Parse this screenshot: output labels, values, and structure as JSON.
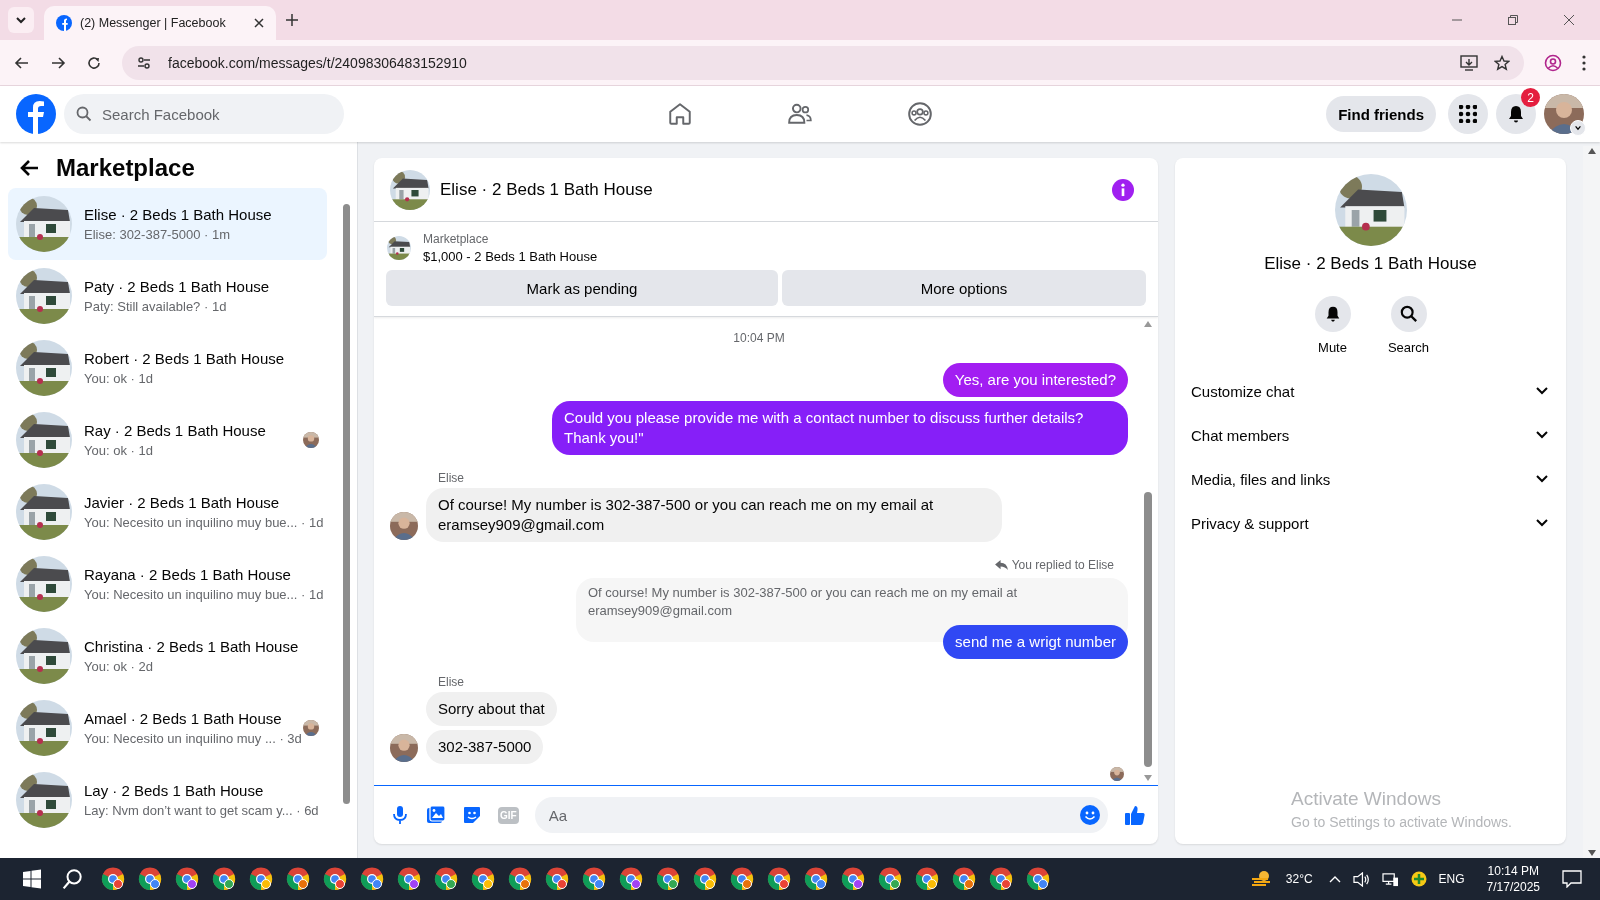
{
  "browser": {
    "tab_title": "(2) Messenger | Facebook",
    "url": "facebook.com/messages/t/24098306483152910"
  },
  "header": {
    "search_placeholder": "Search Facebook",
    "find_friends": "Find friends",
    "notification_count": "2"
  },
  "sidebar": {
    "title": "Marketplace",
    "conversations": [
      {
        "title": "Elise · 2 Beds 1 Bath House",
        "preview": "Elise: 302-387-5000",
        "time": "· 1m",
        "selected": true,
        "read_receipt": false
      },
      {
        "title": "Paty · 2 Beds 1 Bath House",
        "preview": "Paty: Still available?",
        "time": "· 1d",
        "selected": false,
        "read_receipt": false
      },
      {
        "title": "Robert · 2 Beds 1 Bath House",
        "preview": "You: ok",
        "time": "· 1d",
        "selected": false,
        "read_receipt": false
      },
      {
        "title": "Ray · 2 Beds 1 Bath House",
        "preview": "You: ok",
        "time": "· 1d",
        "selected": false,
        "read_receipt": true
      },
      {
        "title": "Javier · 2 Beds 1 Bath House",
        "preview": "You: Necesito un inquilino muy bue...",
        "time": "· 1d",
        "selected": false,
        "read_receipt": false
      },
      {
        "title": "Rayana · 2 Beds 1 Bath House",
        "preview": "You: Necesito un inquilino muy bue...",
        "time": "· 1d",
        "selected": false,
        "read_receipt": false
      },
      {
        "title": "Christina · 2 Beds 1 Bath House",
        "preview": "You: ok",
        "time": "· 2d",
        "selected": false,
        "read_receipt": false
      },
      {
        "title": "Amael · 2 Beds 1 Bath House",
        "preview": "You: Necesito un inquilino muy ...",
        "time": "· 3d",
        "selected": false,
        "read_receipt": true
      },
      {
        "title": "Lay · 2 Beds 1 Bath House",
        "preview": "Lay: Nvm don’t want to get scam y...",
        "time": "· 6d",
        "selected": false,
        "read_receipt": false
      }
    ]
  },
  "chat": {
    "title": "Elise · 2 Beds 1 Bath House",
    "listing": {
      "label": "Marketplace",
      "title": "$1,000 - 2 Beds 1 Bath House"
    },
    "actions": [
      "Mark as pending",
      "More options"
    ],
    "timestamp": "10:04 PM",
    "messages": [
      {
        "kind": "outgoing",
        "text": "Yes, are you interested?",
        "color": "#a21ef2"
      },
      {
        "kind": "outgoing",
        "text": "Could you please provide me with a contact number to discuss further details? Thank you!\"",
        "color": "#861ff8"
      },
      {
        "kind": "incoming",
        "sender": "Elise",
        "bubbles": [
          "Of course! My number is 302-387-500 or you can reach me on my email at eramsey909@gmail.com"
        ]
      },
      {
        "kind": "reply",
        "note": "You replied to Elise",
        "quoted": "Of course! My number is 302-387-500 or you can reach me on my email at eramsey909@gmail.com",
        "text": "send me a wrigt number",
        "color": "#3048f4"
      },
      {
        "kind": "incoming",
        "sender": "Elise",
        "bubbles": [
          "Sorry about that",
          "302-387-5000"
        ]
      }
    ],
    "seen": true,
    "composer": {
      "gif_label": "GIF",
      "placeholder": "Aa"
    }
  },
  "details": {
    "title": "Elise · 2 Beds 1 Bath House",
    "actions": [
      {
        "kind": "mute",
        "label": "Mute"
      },
      {
        "kind": "search",
        "label": "Search"
      }
    ],
    "sections": [
      "Customize chat",
      "Chat members",
      "Media, files and links",
      "Privacy & support"
    ]
  },
  "system_notice": {
    "title": "Activate Windows",
    "subtitle": "Go to Settings to activate Windows."
  },
  "taskbar": {
    "temperature": "32°C",
    "language": "ENG",
    "time": "10:14 PM",
    "date": "7/17/2025"
  }
}
